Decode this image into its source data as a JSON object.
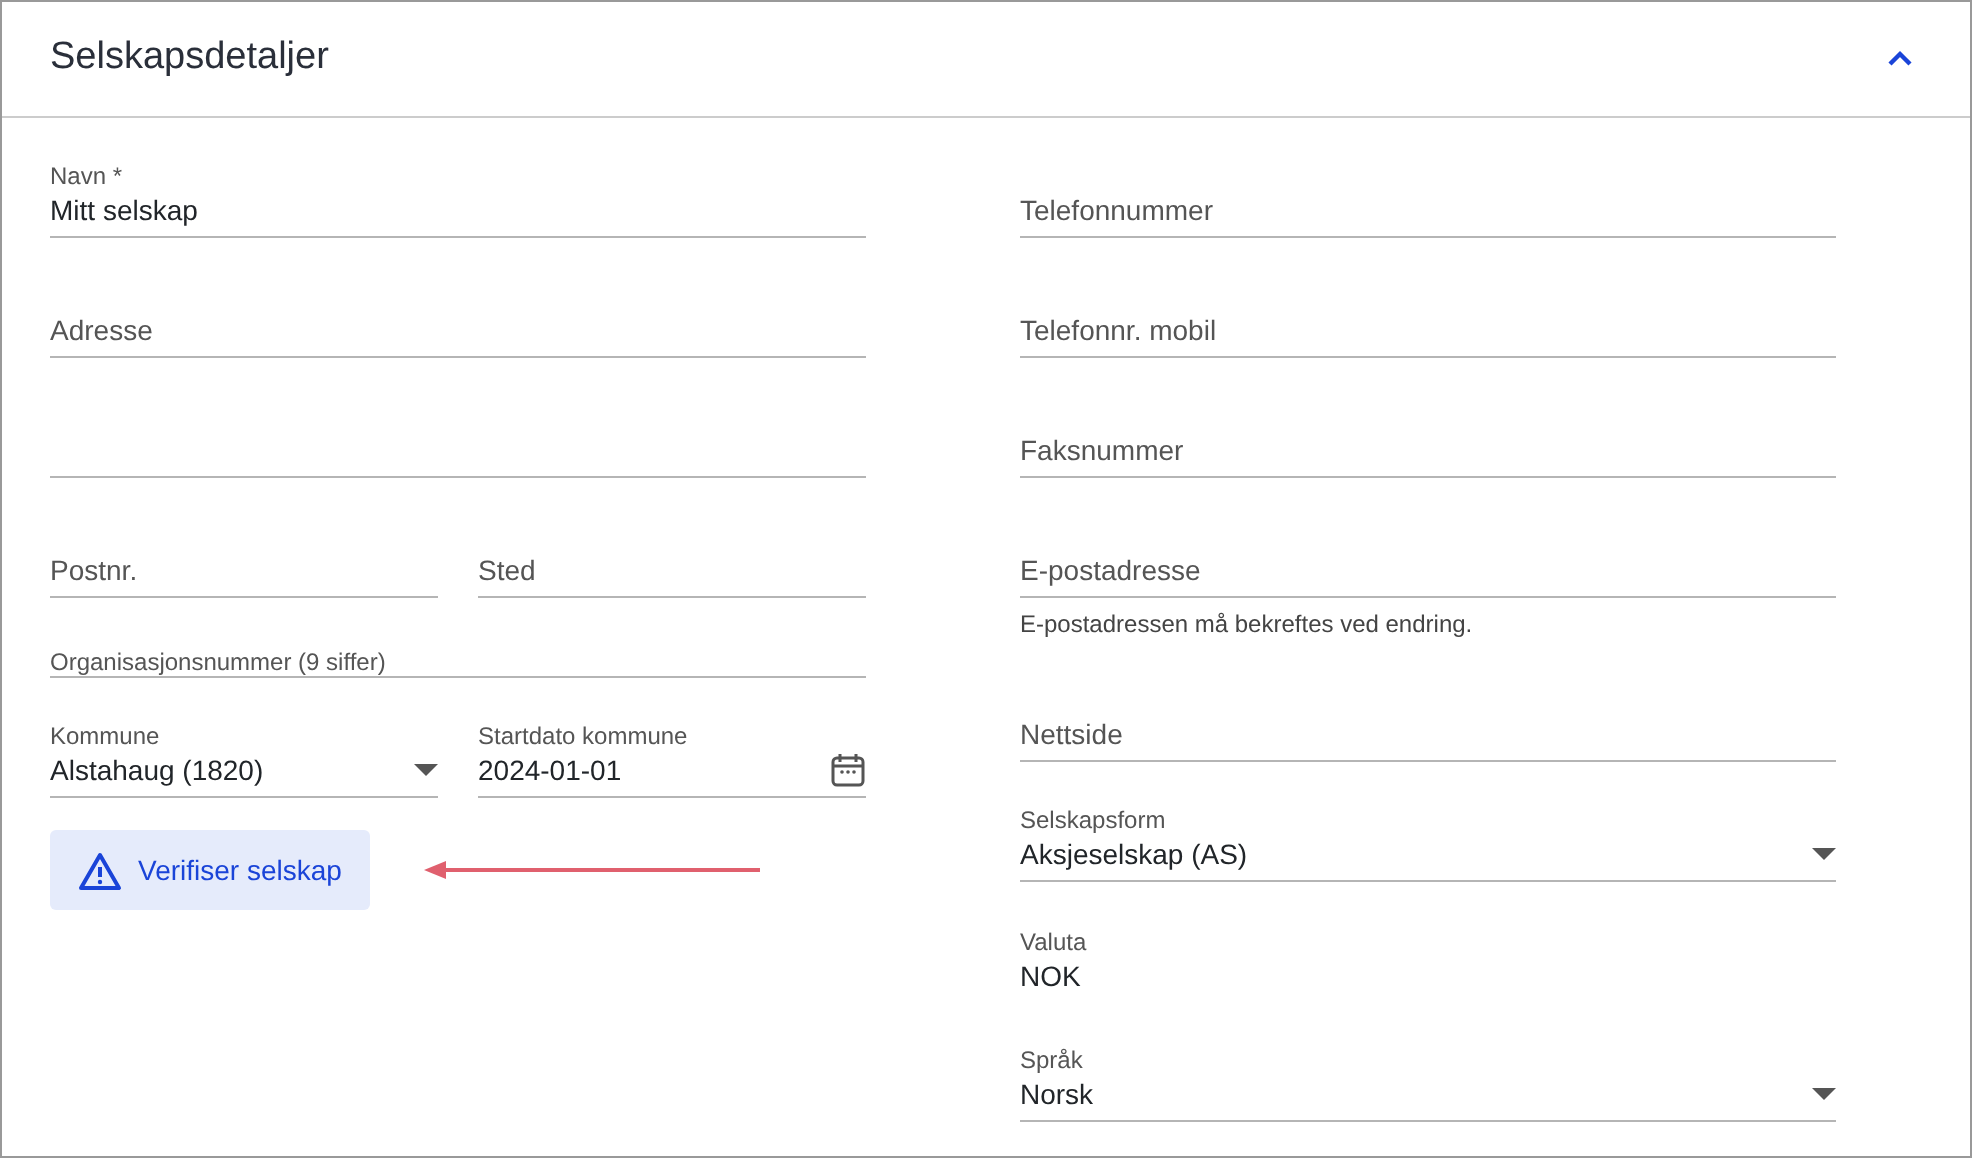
{
  "panel": {
    "title": "Selskapsdetaljer",
    "expanded": true
  },
  "left_fields": [
    {
      "kind": "text",
      "label": "Navn *",
      "value": "Mitt selskap"
    },
    {
      "kind": "text",
      "label": "Adresse"
    },
    {
      "kind": "text"
    },
    {
      "kind": "row",
      "fields": [
        {
          "kind": "text",
          "label": "Postnr."
        },
        {
          "kind": "text",
          "label": "Sted"
        }
      ]
    },
    {
      "kind": "labeled_empty",
      "label": "Organisasjonsnummer (9 siffer)"
    },
    {
      "kind": "row",
      "fields": [
        {
          "kind": "select",
          "label": "Kommune",
          "value": "Alstahaug (1820)"
        },
        {
          "kind": "date",
          "label": "Startdato kommune",
          "value": "2024-01-01"
        }
      ]
    },
    {
      "kind": "button",
      "label": "Verifiser selskap",
      "callout_arrow": true
    }
  ],
  "right_fields": [
    {
      "kind": "text",
      "label": "Telefonnummer"
    },
    {
      "kind": "text",
      "label": "Telefonnr. mobil"
    },
    {
      "kind": "text",
      "label": "Faksnummer"
    },
    {
      "kind": "text",
      "label": "E-postadresse",
      "helper": "E-postadressen må bekreftes ved endring."
    },
    {
      "kind": "text",
      "label": "Nettside"
    },
    {
      "kind": "select",
      "label": "Selskapsform",
      "value": "Aksjeselskap (AS)"
    },
    {
      "kind": "static",
      "label": "Valuta",
      "value": "NOK"
    },
    {
      "kind": "select",
      "label": "Språk",
      "value": "Norsk"
    }
  ]
}
